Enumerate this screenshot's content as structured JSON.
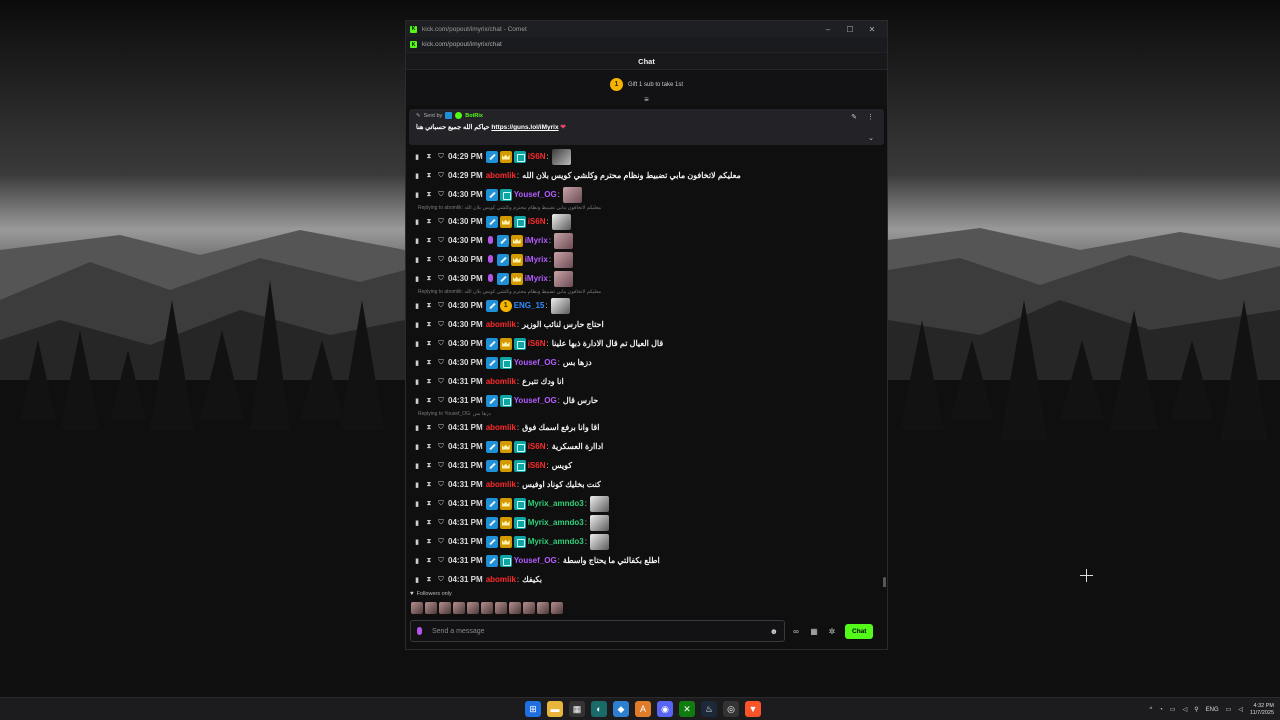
{
  "window": {
    "title": "kick.com/popout/imyrix/chat - Comet",
    "url": "kick.com/popout/imyrix/chat",
    "controls": [
      "–",
      "☐",
      "✕"
    ]
  },
  "chat": {
    "header": "Chat",
    "gift": {
      "coin": "1",
      "label": "Gift 1 sub to take 1st"
    },
    "pinned": {
      "sent_by_label": "Sent by",
      "sender": "BotRix",
      "text": "حياكم الله جميع حسباتي هنا",
      "link": "https://guns.lol/iMyrix",
      "heart": "❤"
    },
    "messages": [
      {
        "type": "msg",
        "time": "04:29 PM",
        "badges": [
          "sword",
          "crown",
          "ok"
        ],
        "user": "iS6N",
        "color": "#ff2a2a",
        "text": "",
        "emote": "dark"
      },
      {
        "type": "msg",
        "time": "04:29 PM",
        "badges": [],
        "user": "abomlik",
        "color": "#ff2a2a",
        "text": "معليكم لاتخافون مابي تضبيط ونظام محترم وكلشي كويس بلان الله",
        "emote": ""
      },
      {
        "type": "msg",
        "time": "04:30 PM",
        "badges": [
          "sword",
          "ok"
        ],
        "user": "Yousef_OG",
        "color": "#b35cff",
        "text": "",
        "emote": "pink"
      },
      {
        "type": "reply",
        "text": "Replying to abomlik: معليكم لاتخافون مابي تضبيط ونظام محترم وكلشي كويس بلان الله"
      },
      {
        "type": "msg",
        "time": "04:30 PM",
        "badges": [
          "sword",
          "crown",
          "ok"
        ],
        "user": "iS6N",
        "color": "#ff2a2a",
        "text": "",
        "emote": "bw"
      },
      {
        "type": "msg",
        "time": "04:30 PM",
        "badges": [
          "mic",
          "sword",
          "crown"
        ],
        "user": "iMyrix",
        "color": "#b35cff",
        "text": "",
        "emote": "pink"
      },
      {
        "type": "msg",
        "time": "04:30 PM",
        "badges": [
          "mic",
          "sword",
          "crown"
        ],
        "user": "iMyrix",
        "color": "#b35cff",
        "text": "",
        "emote": "pink"
      },
      {
        "type": "msg",
        "time": "04:30 PM",
        "badges": [
          "mic",
          "sword",
          "crown"
        ],
        "user": "iMyrix",
        "color": "#b35cff",
        "text": "",
        "emote": "pink"
      },
      {
        "type": "reply",
        "text": "Replying to abomlik: معليكم لاتخافون مابي تضبيط ونظام محترم وكلشي كويس بلان الله"
      },
      {
        "type": "msg",
        "time": "04:30 PM",
        "badges": [
          "sword",
          "num"
        ],
        "user": "ENG_15",
        "color": "#2f8cff",
        "text": "",
        "emote": "bw"
      },
      {
        "type": "msg",
        "time": "04:30 PM",
        "badges": [],
        "user": "abomlik",
        "color": "#ff2a2a",
        "text": "احتاج حارس لنائب الوزير",
        "emote": ""
      },
      {
        "type": "msg",
        "time": "04:30 PM",
        "badges": [
          "sword",
          "crown",
          "ok"
        ],
        "user": "iS6N",
        "color": "#ff2a2a",
        "text": "قال العيال تم قال الادارة ذبها علينا",
        "emote": ""
      },
      {
        "type": "msg",
        "time": "04:30 PM",
        "badges": [
          "sword",
          "ok"
        ],
        "user": "Yousef_OG",
        "color": "#b35cff",
        "text": "دزها بس",
        "emote": ""
      },
      {
        "type": "msg",
        "time": "04:31 PM",
        "badges": [],
        "user": "abomlik",
        "color": "#ff2a2a",
        "text": "انا ودك تتبرع",
        "emote": ""
      },
      {
        "type": "msg",
        "time": "04:31 PM",
        "badges": [
          "sword",
          "ok"
        ],
        "user": "Yousef_OG",
        "color": "#b35cff",
        "text": "حارس قال",
        "emote": ""
      },
      {
        "type": "reply",
        "text": "Replying to Yousef_OG: دزها بس"
      },
      {
        "type": "msg",
        "time": "04:31 PM",
        "badges": [],
        "user": "abomlik",
        "color": "#ff2a2a",
        "text": "اقا وانا برفع اسمك فوق",
        "emote": ""
      },
      {
        "type": "msg",
        "time": "04:31 PM",
        "badges": [
          "sword",
          "crown",
          "ok"
        ],
        "user": "iS6N",
        "color": "#ff2a2a",
        "text": "اداارة العسكرية",
        "emote": ""
      },
      {
        "type": "msg",
        "time": "04:31 PM",
        "badges": [
          "sword",
          "crown",
          "ok"
        ],
        "user": "iS6N",
        "color": "#ff2a2a",
        "text": "كويس",
        "emote": ""
      },
      {
        "type": "msg",
        "time": "04:31 PM",
        "badges": [],
        "user": "abomlik",
        "color": "#ff2a2a",
        "text": "كنت بخليك كوناد اوفيس",
        "emote": ""
      },
      {
        "type": "msg",
        "time": "04:31 PM",
        "badges": [
          "sword",
          "crown",
          "ok"
        ],
        "user": "Myrix_amndo3",
        "color": "#2fd17a",
        "text": "",
        "emote": "bw"
      },
      {
        "type": "msg",
        "time": "04:31 PM",
        "badges": [
          "sword",
          "crown",
          "ok"
        ],
        "user": "Myrix_amndo3",
        "color": "#2fd17a",
        "text": "",
        "emote": "bw"
      },
      {
        "type": "msg",
        "time": "04:31 PM",
        "badges": [
          "sword",
          "crown",
          "ok"
        ],
        "user": "Myrix_amndo3",
        "color": "#2fd17a",
        "text": "",
        "emote": "bw"
      },
      {
        "type": "msg",
        "time": "04:31 PM",
        "badges": [
          "sword",
          "ok"
        ],
        "user": "Yousef_OG",
        "color": "#b35cff",
        "text": "اطلع بكفالتي ما يحتاج واسطة",
        "emote": ""
      },
      {
        "type": "msg",
        "time": "04:31 PM",
        "badges": [],
        "user": "abomlik",
        "color": "#ff2a2a",
        "text": "بكيفك",
        "emote": ""
      }
    ],
    "followers_only": "Followers only",
    "input_placeholder": "Send a message",
    "send_label": "Chat"
  },
  "taskbar": {
    "lang": "ENG",
    "time": "4:32 PM",
    "date": "11/7/2025"
  },
  "colors": {
    "kick_green": "#53fc18",
    "bg": "#0f0f10"
  }
}
